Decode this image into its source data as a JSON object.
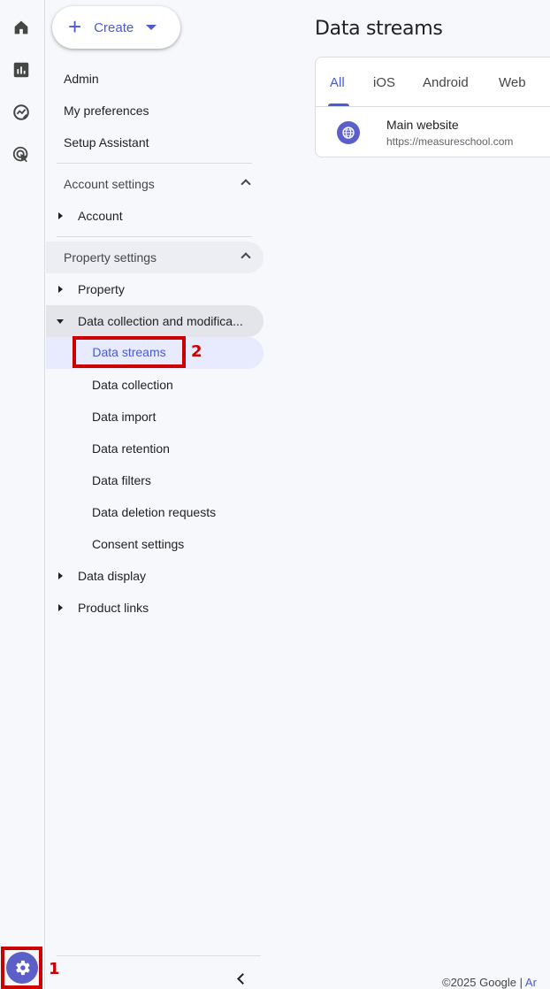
{
  "rail": {
    "icons": [
      "home-icon",
      "reports-icon",
      "explore-icon",
      "advertising-icon"
    ],
    "settings_icon": "gear-icon"
  },
  "nav": {
    "create_label": "Create",
    "top_items": [
      "Admin",
      "My preferences",
      "Setup Assistant"
    ],
    "account_settings": {
      "label": "Account settings",
      "items": [
        "Account"
      ]
    },
    "property_settings": {
      "label": "Property settings",
      "property": "Property",
      "data_collection": "Data collection and modifica...",
      "data_collection_children": [
        "Data streams",
        "Data collection",
        "Data import",
        "Data retention",
        "Data filters",
        "Data deletion requests",
        "Consent settings"
      ],
      "data_display": "Data display",
      "product_links": "Product links"
    }
  },
  "annotations": {
    "step1": "1",
    "step2": "2"
  },
  "main": {
    "title": "Data streams",
    "tabs": [
      "All",
      "iOS",
      "Android",
      "Web"
    ],
    "active_tab": "All",
    "stream": {
      "name": "Main website",
      "url": "https://measureschool.com"
    }
  },
  "footer": {
    "copyright": "©2025 Google | ",
    "link": "Ar"
  },
  "colors": {
    "accent": "#4c5ad3",
    "annotation": "#cc0000",
    "background": "#f6f8fb"
  }
}
